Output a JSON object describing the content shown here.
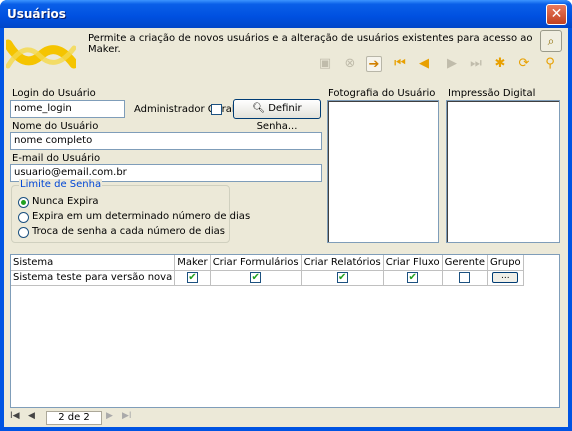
{
  "window": {
    "title": "Usuários",
    "close_glyph": "✕"
  },
  "header": {
    "description": "Permite a criação de novos usuários e a alteração de usuários existentes para acesso ao Maker."
  },
  "toolbar": {
    "icons": [
      "save-icon",
      "cancel-icon",
      "new-icon",
      "first-icon",
      "previous-icon",
      "next-icon",
      "last-icon",
      "delete-icon",
      "refresh-icon",
      "search-icon"
    ]
  },
  "form": {
    "login_label": "Login do Usuário",
    "login_value": "nome_login",
    "admin_label": "Administrador Geral",
    "define_password_label": "Definir Senha...",
    "name_label": "Nome do Usuário",
    "name_value": "nome completo",
    "email_label": "E-mail do Usuário",
    "email_value": "usuario@email.com.br",
    "password_limit": {
      "title": "Limite de Senha",
      "options": [
        "Nunca Expira",
        "Expira em um determinado número de dias",
        "Troca de senha a cada número de dias"
      ],
      "selected": 0
    },
    "photo_label": "Fotografia do Usuário",
    "fingerprint_label": "Impressão Digital"
  },
  "grid": {
    "columns": [
      "Sistema",
      "Maker",
      "Criar Formulários",
      "Criar Relatórios",
      "Criar Fluxo",
      "Gerente",
      "Grupo"
    ],
    "rows": [
      {
        "sistema": "Sistema teste para versão nova",
        "maker": true,
        "criar_formularios": true,
        "criar_relatorios": true,
        "criar_fluxo": true,
        "gerente": false,
        "grupo": "..."
      }
    ]
  },
  "navigator": {
    "page": "2 de 2"
  },
  "colors": {
    "titlebar": "#0054e3",
    "face": "#ece9d8",
    "accent": "#e8a000"
  }
}
